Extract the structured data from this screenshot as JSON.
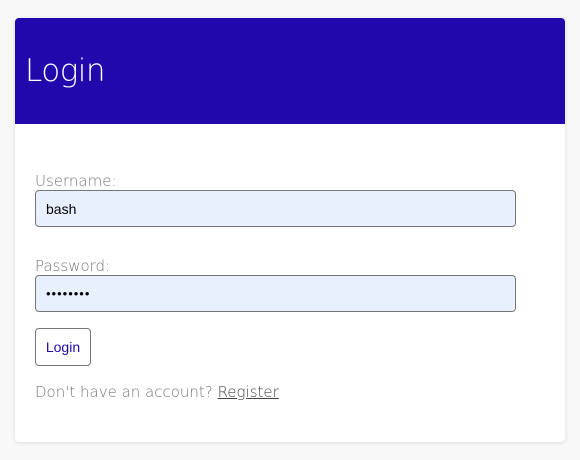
{
  "header": {
    "title": "Login"
  },
  "form": {
    "username_label": "Username:",
    "username_value": "bash",
    "password_label": "Password:",
    "password_value": "••••••••",
    "login_button": "Login",
    "register_prompt": "Don't have an account?",
    "register_link": "Register"
  },
  "colors": {
    "header_bg": "#2108ad",
    "input_bg": "#e8f0fe",
    "page_bg": "#f8f8f8"
  }
}
